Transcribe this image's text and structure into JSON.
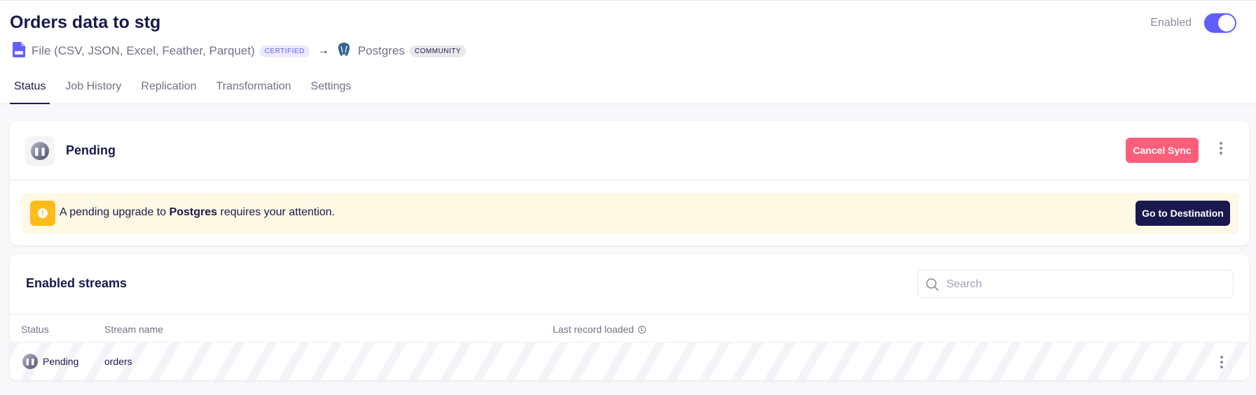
{
  "connection": {
    "title": "Orders data to stg",
    "source": {
      "name": "File (CSV, JSON, Excel, Feather, Parquet)",
      "badge": "CERTIFIED",
      "icon": "file-icon"
    },
    "arrow": "→",
    "destination": {
      "name": "Postgres",
      "badge": "COMMUNITY",
      "icon": "postgres-elephant-icon"
    },
    "enabled_label": "Enabled",
    "enabled": true
  },
  "tabs": [
    {
      "label": "Status",
      "active": true
    },
    {
      "label": "Job History",
      "active": false
    },
    {
      "label": "Replication",
      "active": false
    },
    {
      "label": "Transformation",
      "active": false
    },
    {
      "label": "Settings",
      "active": false
    }
  ],
  "status_card": {
    "status": "Pending",
    "cancel_button": "Cancel Sync",
    "banner": {
      "prefix": "A pending upgrade to ",
      "connector": "Postgres",
      "suffix": " requires your attention.",
      "button": "Go to Destination"
    }
  },
  "streams": {
    "title": "Enabled streams",
    "search_placeholder": "Search",
    "columns": {
      "status": "Status",
      "name": "Stream name",
      "last_record": "Last record loaded"
    },
    "rows": [
      {
        "status": "Pending",
        "name": "orders"
      }
    ]
  },
  "colors": {
    "accent": "#615eff",
    "cancel": "#ff5e7b",
    "warning": "#fdbc1a",
    "banner_bg": "#fef8e4",
    "dark_button": "#1a194d"
  }
}
